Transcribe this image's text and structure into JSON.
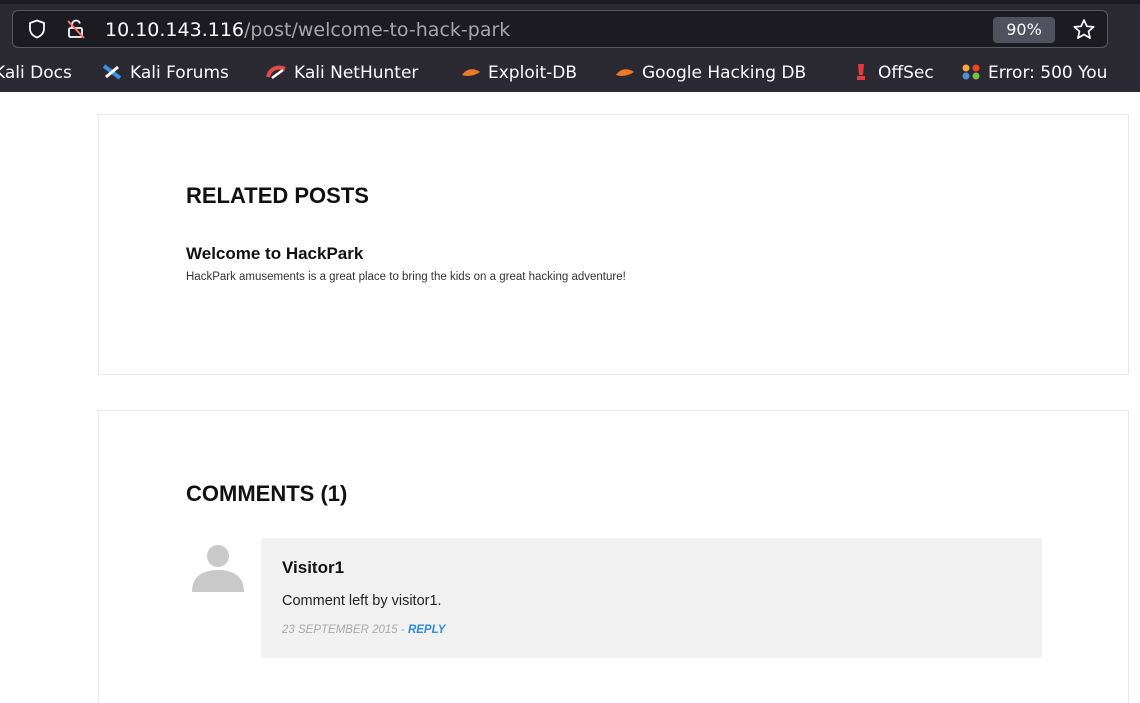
{
  "browser": {
    "url_host": "10.10.143.116",
    "url_path": "/post/welcome-to-hack-park",
    "zoom": "90%",
    "bookmarks": [
      {
        "label": "Kali Docs",
        "icon": "kali-docs-icon"
      },
      {
        "label": "Kali Forums",
        "icon": "kali-forums-icon"
      },
      {
        "label": "Kali NetHunter",
        "icon": "kali-nethunter-icon"
      },
      {
        "label": "Exploit-DB",
        "icon": "exploit-db-icon"
      },
      {
        "label": "Google Hacking DB",
        "icon": "ghdb-icon"
      },
      {
        "label": "OffSec",
        "icon": "offsec-icon"
      },
      {
        "label": "Error: 500 You",
        "icon": "joomla-icon"
      }
    ]
  },
  "related": {
    "title": "RELATED POSTS",
    "post": {
      "title": "Welcome to HackPark",
      "excerpt": "HackPark amusements is a great place to bring the kids on a great hacking adventure!"
    }
  },
  "comments": {
    "title": "COMMENTS (1)",
    "items": [
      {
        "author": "Visitor1",
        "text": "Comment left by visitor1.",
        "date": "23 SEPTEMBER 2015",
        "separator": " - ",
        "reply_label": "REPLY"
      }
    ]
  },
  "colors": {
    "chrome_bg": "#2b2a33",
    "url_bar_bg": "#1c1b22",
    "reply_link": "#2d8be0",
    "comment_bg": "#f1f1f1"
  }
}
